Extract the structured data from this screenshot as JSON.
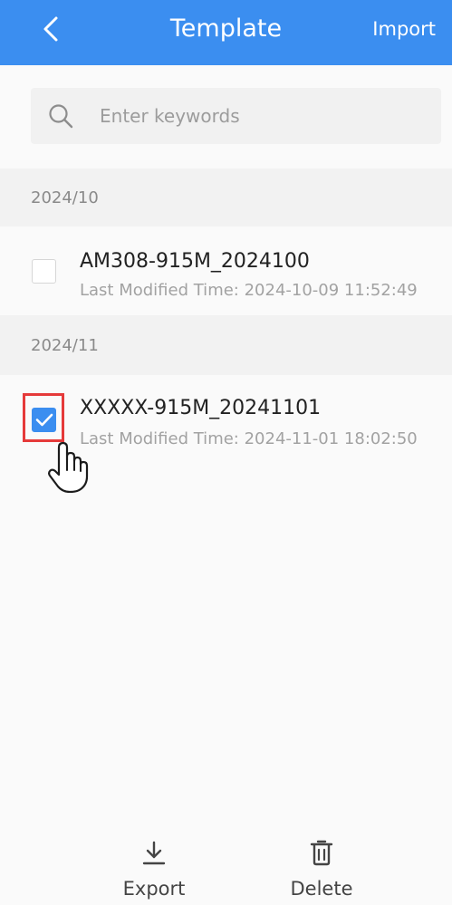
{
  "header": {
    "title": "Template",
    "import_label": "Import"
  },
  "search": {
    "placeholder": "Enter keywords"
  },
  "groups": [
    {
      "label": "2024/10",
      "items": [
        {
          "title": "AM308-915M_2024100",
          "meta": "Last Modified Time: 2024-10-09 11:52:49",
          "checked": false
        }
      ]
    },
    {
      "label": "2024/11",
      "items": [
        {
          "title": "XXXXX-915M_20241101",
          "meta": "Last Modified Time: 2024-11-01 18:02:50",
          "checked": true
        }
      ]
    }
  ],
  "toolbar": {
    "export_label": "Export",
    "delete_label": "Delete"
  },
  "colors": {
    "accent": "#3b8ef0",
    "highlight": "#e53a3a"
  },
  "icons": [
    "back-arrow-icon",
    "search-icon",
    "checkmark-icon",
    "export-icon",
    "delete-icon",
    "hand-cursor-icon"
  ]
}
